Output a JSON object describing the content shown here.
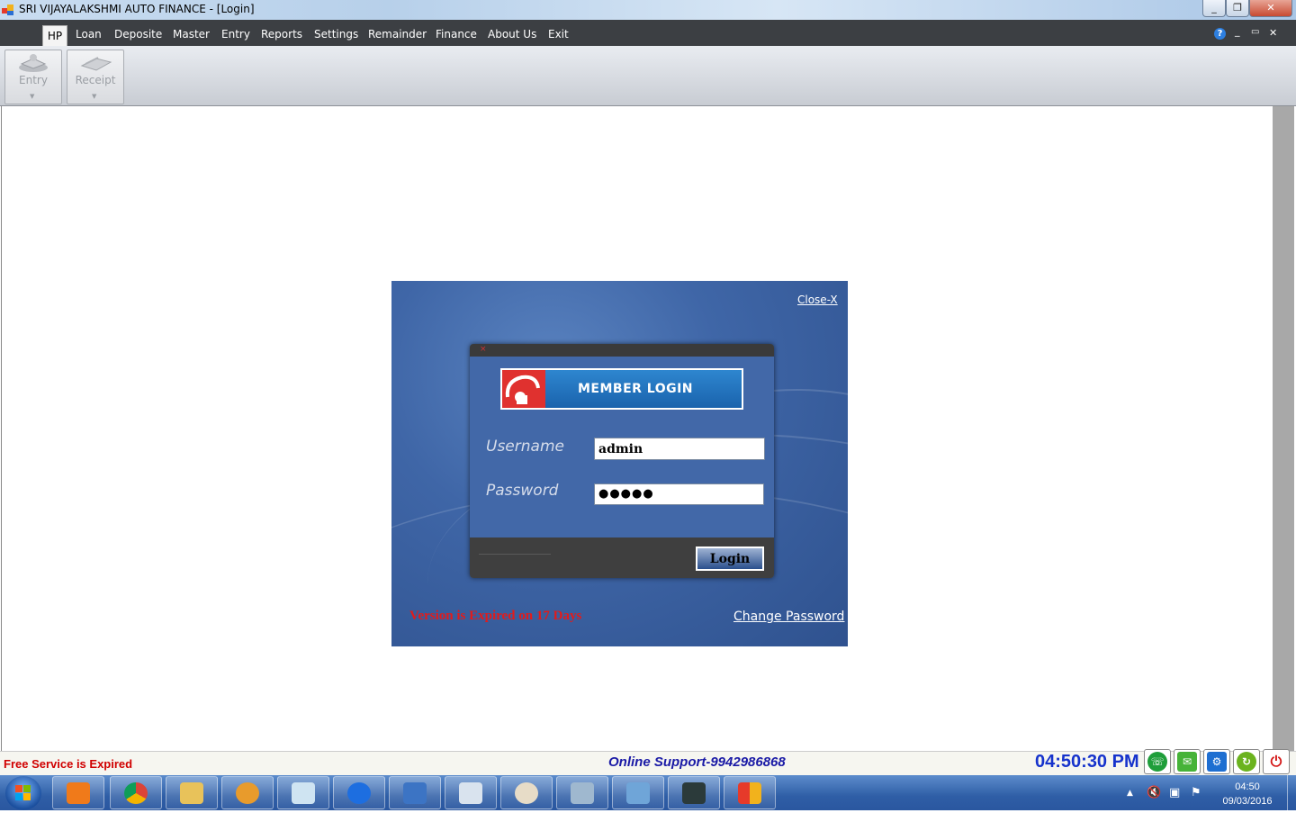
{
  "window": {
    "title": "SRI VIJAYALAKSHMI AUTO FINANCE - [Login]",
    "controls": [
      "_",
      "❐",
      "✕"
    ]
  },
  "menu": {
    "items": [
      "HP",
      "Loan",
      "Deposite",
      "Master",
      "Entry",
      "Reports",
      "Settings",
      "Remainder",
      "Finance",
      "About Us",
      "Exit"
    ],
    "right_icons": [
      "?",
      "_",
      "▭",
      "✕"
    ]
  },
  "ribbon": {
    "buttons": [
      {
        "label": "Entry",
        "icon": "book-icon"
      },
      {
        "label": "Receipt",
        "icon": "receipt-icon"
      }
    ]
  },
  "login": {
    "close_label": "Close-X",
    "banner_title": "MEMBER LOGIN",
    "username_label": "Username",
    "username_value": "admin",
    "password_label": "Password",
    "password_value": "●●●●●",
    "login_button": "Login",
    "expiry_notice": "Version is Expired on 17 Days",
    "change_password": "Change Password"
  },
  "status": {
    "left_text": "Free Service is Expired",
    "support_text": "Online Support-9942986868",
    "clock": "04:50:30 PM",
    "buttons": [
      {
        "icon": "phone-icon",
        "color": "#1f9e3a"
      },
      {
        "icon": "mail-icon",
        "color": "#46b338"
      },
      {
        "icon": "settings-icon",
        "color": "#1e6fd1"
      },
      {
        "icon": "refresh-icon",
        "color": "#6bb31e"
      },
      {
        "icon": "power-icon",
        "color": "#d41818"
      }
    ]
  },
  "taskbar": {
    "apps": [
      "media-player-icon",
      "chrome-icon",
      "file-explorer-icon",
      "paint-icon",
      "notepad-icon",
      "teamviewer-icon",
      "computer-icon",
      "calculator-icon",
      "paint-palette-icon",
      "tools-icon",
      "photo-viewer-icon",
      "terminal-icon",
      "app-icon"
    ],
    "tray_time": "04:50",
    "tray_date": "09/03/2016"
  }
}
